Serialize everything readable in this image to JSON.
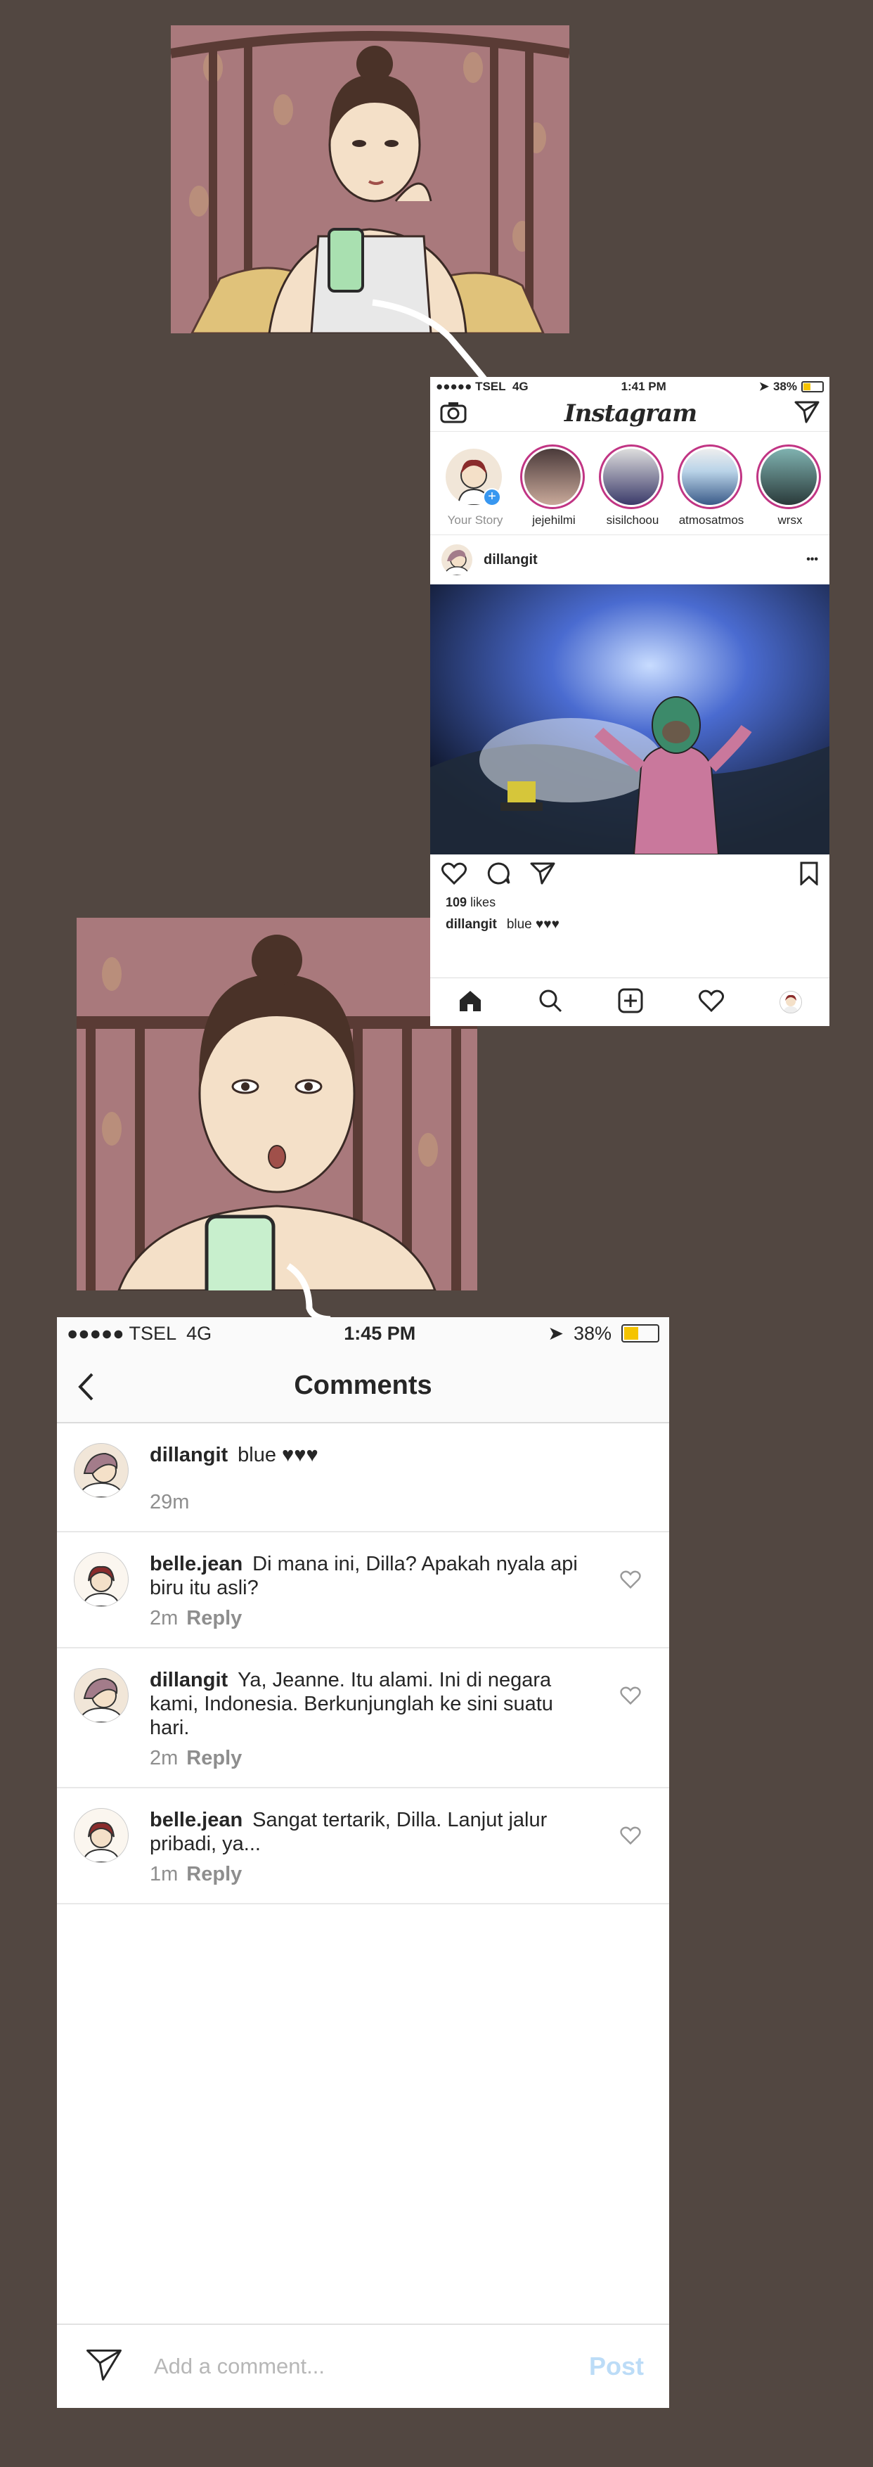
{
  "screen1": {
    "status": {
      "carrier": "●●●●● TSEL",
      "network": "4G",
      "time": "1:41 PM",
      "battery": "38%"
    },
    "header": {
      "logo": "Instagram",
      "camera_icon": "camera-icon",
      "direct_icon": "paper-plane-icon"
    },
    "stories": [
      {
        "label": "Your Story",
        "own": true
      },
      {
        "label": "jejehilmi"
      },
      {
        "label": "sisilchoou"
      },
      {
        "label": "atmosatmos"
      },
      {
        "label": "wrsx"
      }
    ],
    "post": {
      "username": "dillangit",
      "more": "•••",
      "likes_count": "109",
      "likes_word": "likes",
      "caption_user": "dillangit",
      "caption_text": "blue ♥♥♥"
    },
    "tabbar": [
      "home-icon",
      "search-icon",
      "add-post-icon",
      "heart-icon",
      "profile-icon"
    ]
  },
  "screen2": {
    "status": {
      "carrier": "●●●●● TSEL",
      "network": "4G",
      "time": "1:45 PM",
      "battery": "38%"
    },
    "header": {
      "title": "Comments"
    },
    "comments": [
      {
        "user": "dillangit",
        "text": "blue ♥♥♥",
        "time": "29m",
        "reply": ""
      },
      {
        "user": "belle.jean",
        "text": "Di mana ini, Dilla? Apakah nyala api biru itu asli?",
        "time": "2m",
        "reply": "Reply"
      },
      {
        "user": "dillangit",
        "text": "Ya, Jeanne. Itu alami. Ini di negara kami, Indonesia. Berkunjunglah ke sini suatu hari.",
        "time": "2m",
        "reply": "Reply"
      },
      {
        "user": "belle.jean",
        "text": "Sangat tertarik, Dilla. Lanjut jalur pribadi, ya...",
        "time": "1m",
        "reply": "Reply"
      }
    ],
    "composer": {
      "placeholder": "Add a comment...",
      "post_label": "Post"
    }
  },
  "colors": {
    "background": "#524741",
    "story_ring": "#c13584",
    "post_button": "#bcdcf7",
    "wallpaper": "#a9797c"
  }
}
